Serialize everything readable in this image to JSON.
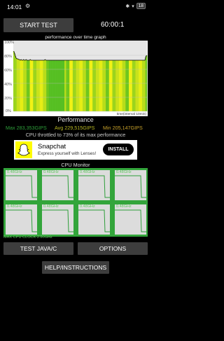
{
  "status_bar": {
    "time": "14:01",
    "battery": "18"
  },
  "toolbar": {
    "start_label": "START TEST",
    "timer": "60:00:1"
  },
  "graph": {
    "title": "performance over time graph",
    "y_ticks": [
      "100%",
      "80%",
      "60%",
      "40%",
      "20%",
      "0%"
    ],
    "x_note": "time(interval 10min)"
  },
  "chart_data": {
    "type": "area",
    "title": "performance over time graph",
    "xlabel": "time(interval 10min)",
    "ylabel": "",
    "ylim": [
      0,
      100
    ],
    "series": [
      {
        "values": [
          86,
          83,
          79,
          76,
          75,
          75,
          74,
          74,
          73,
          74,
          73,
          73,
          74,
          73,
          73,
          74,
          73,
          73,
          73,
          73,
          74,
          73,
          73,
          73,
          73,
          73,
          73,
          73,
          73,
          73,
          73,
          73,
          73,
          73,
          73,
          73,
          73,
          73,
          74,
          73,
          73,
          73,
          73,
          73,
          73,
          73,
          73,
          73,
          73,
          73,
          73,
          73,
          73,
          73,
          73,
          73,
          73,
          73,
          73,
          73,
          73,
          73,
          73,
          73,
          73,
          73,
          73,
          73,
          73,
          73,
          73,
          73,
          73,
          73,
          73,
          73,
          73,
          73,
          73,
          73,
          73,
          73,
          73,
          73,
          73,
          73,
          73,
          73,
          73,
          73,
          73,
          73,
          73,
          73,
          73,
          73,
          73,
          73,
          73,
          73,
          73,
          73,
          73,
          73,
          73,
          73,
          73,
          73,
          73,
          73,
          73,
          73,
          73,
          73,
          73,
          73,
          73,
          73,
          73,
          73,
          73,
          73,
          73,
          73,
          73,
          73,
          73,
          73,
          73,
          73,
          73,
          73,
          73,
          73,
          73,
          73,
          73,
          73,
          73,
          73,
          73,
          73,
          73,
          73,
          73,
          73,
          73,
          73,
          73,
          73,
          73,
          73,
          73,
          73,
          73,
          73,
          73,
          73,
          73,
          73,
          78,
          80
        ]
      }
    ]
  },
  "performance": {
    "title": "Performance",
    "max": "Max 283,353GIPS",
    "avg": "Avg 229,515GIPS",
    "min": "Min 205,147GIPS",
    "throttle": "CPU throttled to 73% of its max performance",
    "colors": {
      "max": "#2e9e3a",
      "avg": "#b7b722",
      "min": "#c8a22a"
    }
  },
  "ad": {
    "title": "Snapchat",
    "subtitle": "Express yourself with Lenses!",
    "cta": "INSTALL"
  },
  "cpu_monitor": {
    "title": "CPU Monitor",
    "cores": [
      {
        "label": "0.48GHz",
        "level": 0.85
      },
      {
        "label": "0.48GHz",
        "level": 0.85
      },
      {
        "label": "0.48GHz",
        "level": 0.85
      },
      {
        "label": "0.48GHz",
        "level": 0.85
      },
      {
        "label": "0.48GHz",
        "level": 0.85
      },
      {
        "label": "0.48GHz",
        "level": 0.85
      },
      {
        "label": "0.48GHz",
        "level": 0.85
      },
      {
        "label": "0.48GHz",
        "level": 0.85
      }
    ],
    "max_clock": "MAX CPU CLOCK:2.80GHz"
  },
  "buttons": {
    "test_java": "TEST JAVA/C",
    "options": "OPTIONS",
    "help": "HELP/INSTRUCTIONS"
  }
}
